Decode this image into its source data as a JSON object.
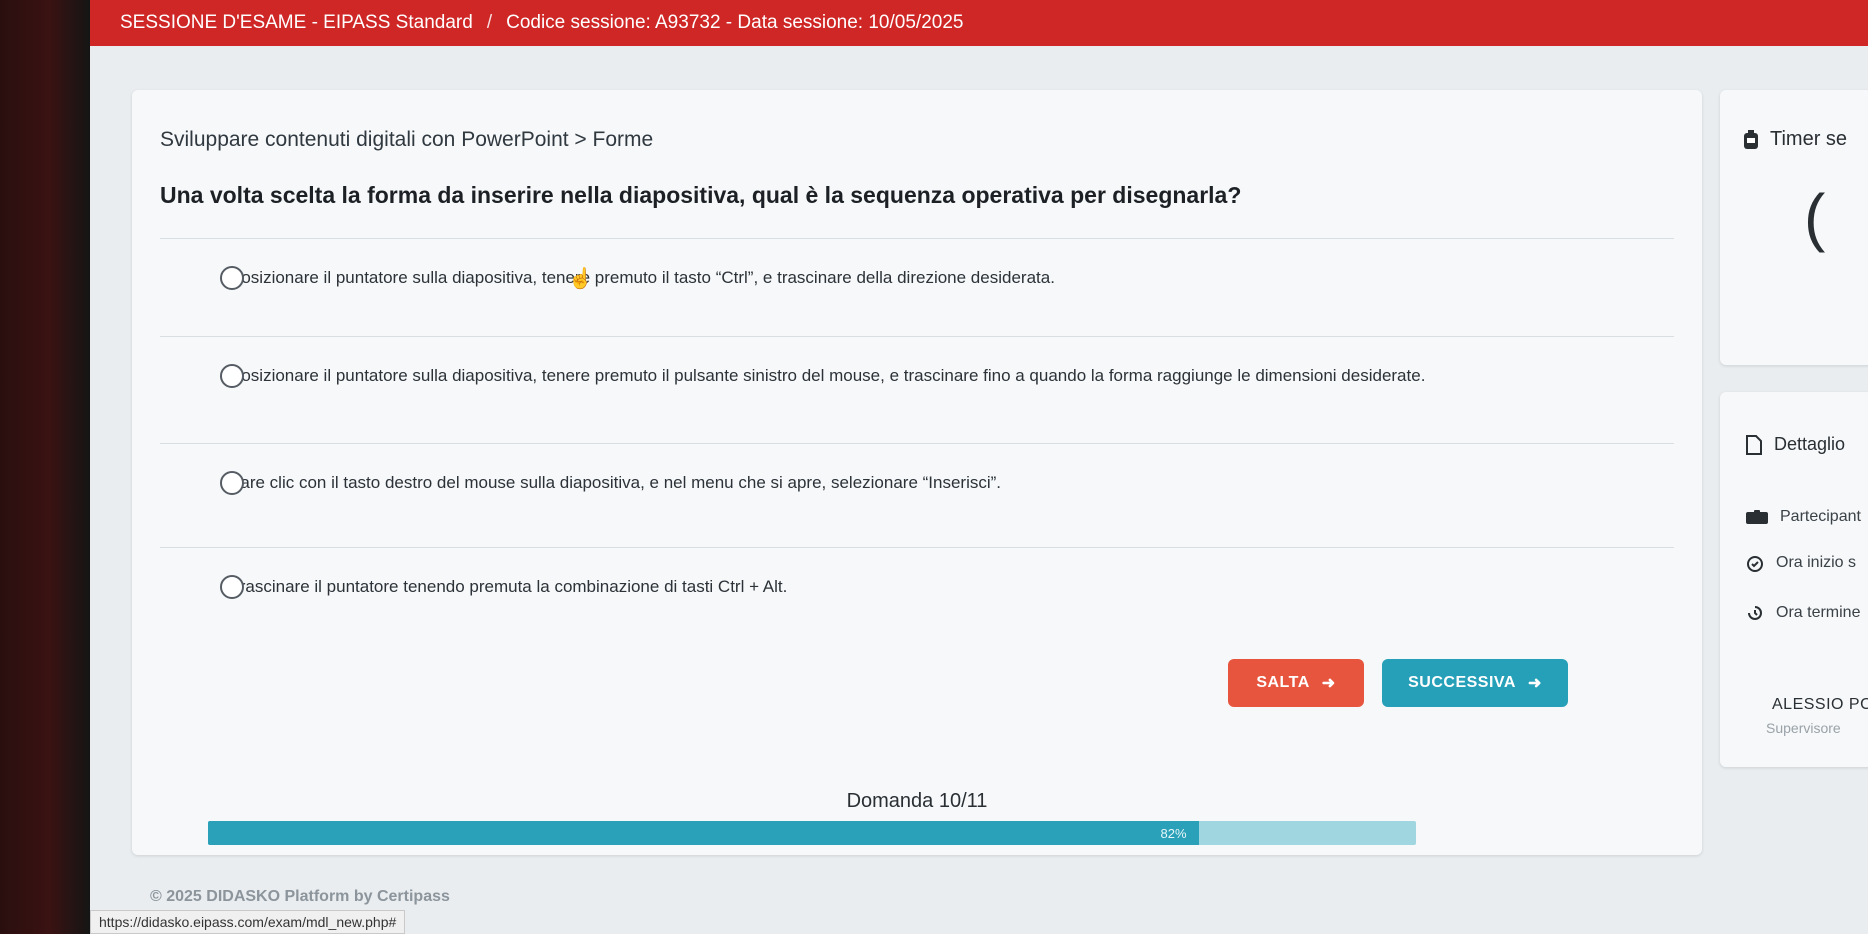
{
  "header": {
    "session_label": "SESSIONE D'ESAME - EIPASS Standard",
    "separator": "/",
    "session_code": "Codice sessione: A93732 - Data sessione: 10/05/2025"
  },
  "main": {
    "breadcrumb": "Sviluppare contenuti digitali con PowerPoint > Forme",
    "question": "Una volta scelta la forma da inserire nella diapositiva, qual è la sequenza operativa per disegnarla?",
    "options": [
      {
        "label": "Posizionare il puntatore sulla diapositiva, tenere premuto il tasto “Ctrl”, e trascinare della direzione desiderata.",
        "selected": false
      },
      {
        "label": "Posizionare il puntatore sulla diapositiva, tenere premuto il pulsante sinistro del mouse, e trascinare fino a quando la forma raggiunge le dimensioni desiderate.",
        "selected": false
      },
      {
        "label": "Fare clic con il tasto destro del mouse sulla diapositiva, e nel menu che si apre, selezionare “Inserisci”.",
        "selected": false
      },
      {
        "label": "Trascinare il puntatore tenendo premuta la combinazione di tasti Ctrl + Alt.",
        "selected": false
      }
    ],
    "skip_label": "SALTA",
    "next_label": "SUCCESSIVA",
    "question_counter": "Domanda 10/11",
    "progress_percent": 82,
    "progress_label": "82%"
  },
  "sidebar": {
    "timer_label": "Timer se",
    "timer_value": "(",
    "details_label": "Dettaglio",
    "participant_label": "Partecipant",
    "start_label": "Ora inizio s",
    "end_label": "Ora termine",
    "supervisor_name": "ALESSIO POL",
    "supervisor_role": "Supervisore"
  },
  "footer": {
    "copyright": "© 2025  DIDASKO Platform by Certipass",
    "status_url": "https://didasko.eipass.com/exam/mdl_new.php#"
  },
  "colors": {
    "header_red": "#cf2626",
    "skip_orange": "#e8553e",
    "next_teal": "#25a0b8",
    "progress_fill": "#2aa1b8"
  }
}
